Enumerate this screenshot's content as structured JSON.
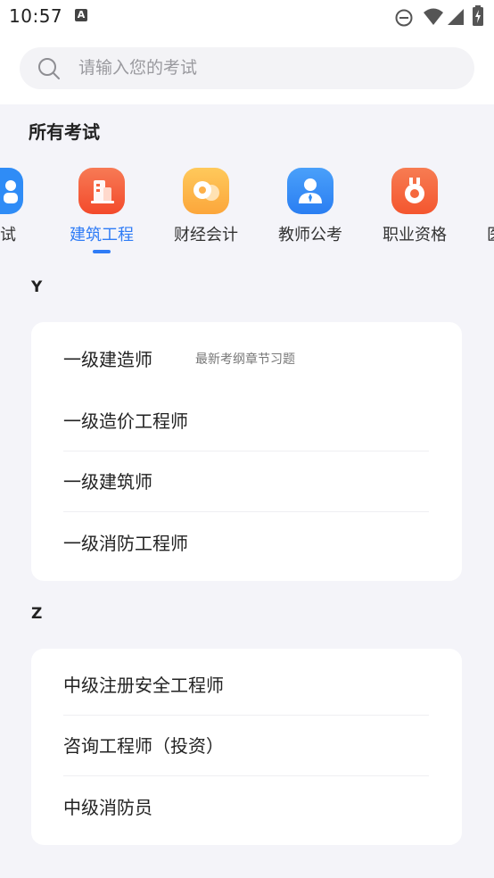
{
  "status_bar": {
    "time": "10:57",
    "icons": [
      "a-notification-icon",
      "do-not-disturb-icon",
      "wifi-icon",
      "signal-icon",
      "battery-charging-icon"
    ]
  },
  "search": {
    "placeholder": "请输入您的考试",
    "icon": "search-icon"
  },
  "section_title": "所有考试",
  "categories": [
    {
      "label": "考试",
      "icon": "partial-category-icon",
      "color": "#2f8cf6",
      "active": false
    },
    {
      "label": "建筑工程",
      "icon": "building-icon",
      "color": "#f5623d",
      "active": true
    },
    {
      "label": "财经会计",
      "icon": "coins-icon",
      "color": "#fdb14a",
      "active": false
    },
    {
      "label": "教师公考",
      "icon": "teacher-icon",
      "color": "#2f8cf6",
      "active": false
    },
    {
      "label": "职业资格",
      "icon": "medal-icon",
      "color": "#f5683d",
      "active": false
    },
    {
      "label": "医",
      "icon": "partial-category-icon",
      "color": "#2f8cf6",
      "active": false
    }
  ],
  "groups": [
    {
      "letter": "Y",
      "items": [
        {
          "name": "一级建造师",
          "tag": "最新考纲章节习题"
        },
        {
          "name": "一级造价工程师",
          "tag": ""
        },
        {
          "name": "一级建筑师",
          "tag": ""
        },
        {
          "name": "一级消防工程师",
          "tag": ""
        }
      ]
    },
    {
      "letter": "Z",
      "items": [
        {
          "name": "中级注册安全工程师",
          "tag": ""
        },
        {
          "name": "咨询工程师（投资）",
          "tag": ""
        },
        {
          "name": "中级消防员",
          "tag": ""
        }
      ]
    }
  ],
  "colors": {
    "accent": "#2f7cf6",
    "background": "#f4f4f9",
    "card": "#ffffff"
  }
}
